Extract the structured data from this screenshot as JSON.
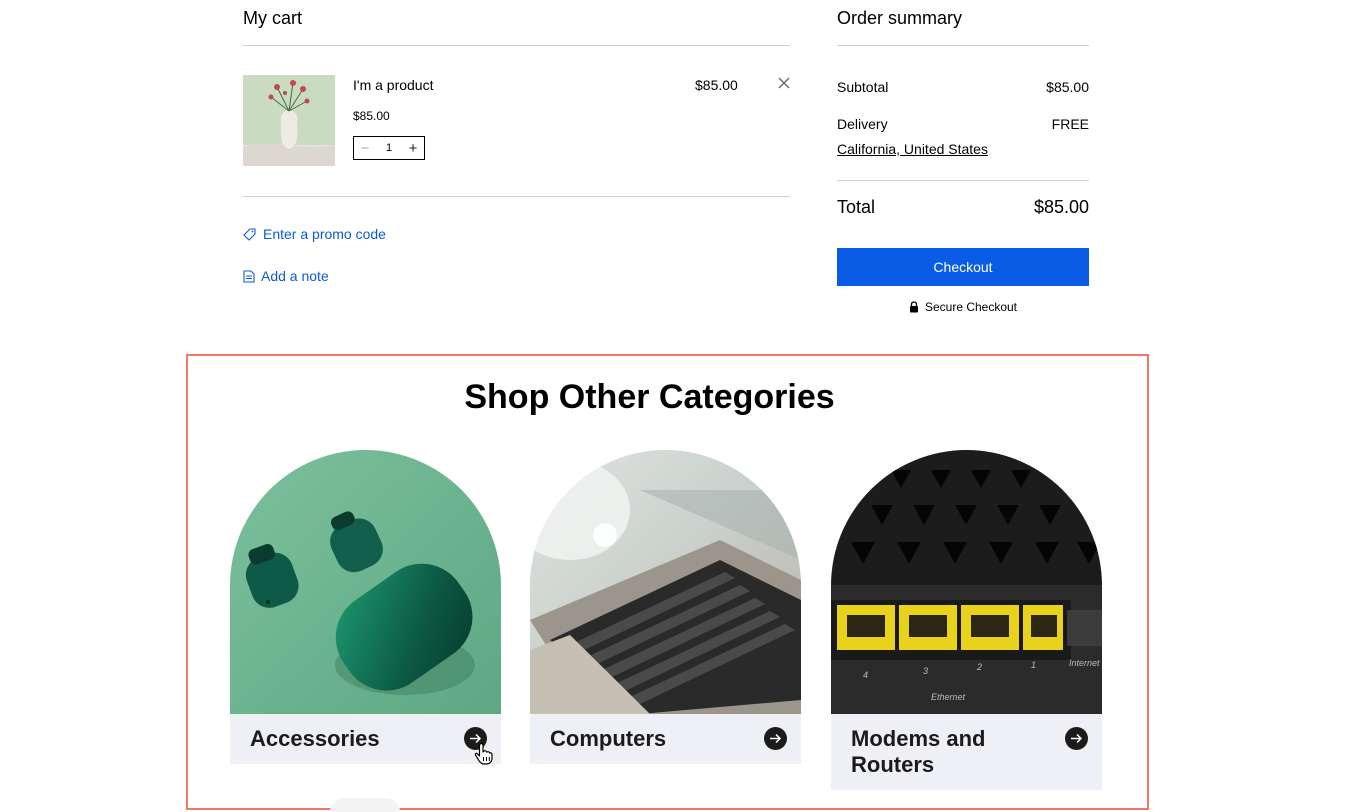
{
  "cart": {
    "title": "My cart",
    "item": {
      "name": "I'm a product",
      "unit_price": "$85.00",
      "quantity": "1",
      "line_price": "$85.00"
    },
    "promo_label": "Enter a promo code",
    "note_label": "Add a note"
  },
  "summary": {
    "title": "Order summary",
    "subtotal_label": "Subtotal",
    "subtotal_value": "$85.00",
    "delivery_label": "Delivery",
    "delivery_value": "FREE",
    "location": "California, United States",
    "total_label": "Total",
    "total_value": "$85.00",
    "checkout_label": "Checkout",
    "secure_label": "Secure Checkout"
  },
  "categories": {
    "title": "Shop Other Categories",
    "items": [
      {
        "label": "Accessories"
      },
      {
        "label": "Computers"
      },
      {
        "label": "Modems and Routers"
      }
    ]
  },
  "colors": {
    "link_blue": "#0a5bd6",
    "checkout_blue": "#0a5be6",
    "highlight_border": "#ee7a64",
    "card_label_bg": "#eff0f6"
  },
  "icons": [
    "tag-icon",
    "note-icon",
    "close-icon",
    "lock-icon",
    "arrow-right-icon",
    "hand-cursor-icon"
  ]
}
